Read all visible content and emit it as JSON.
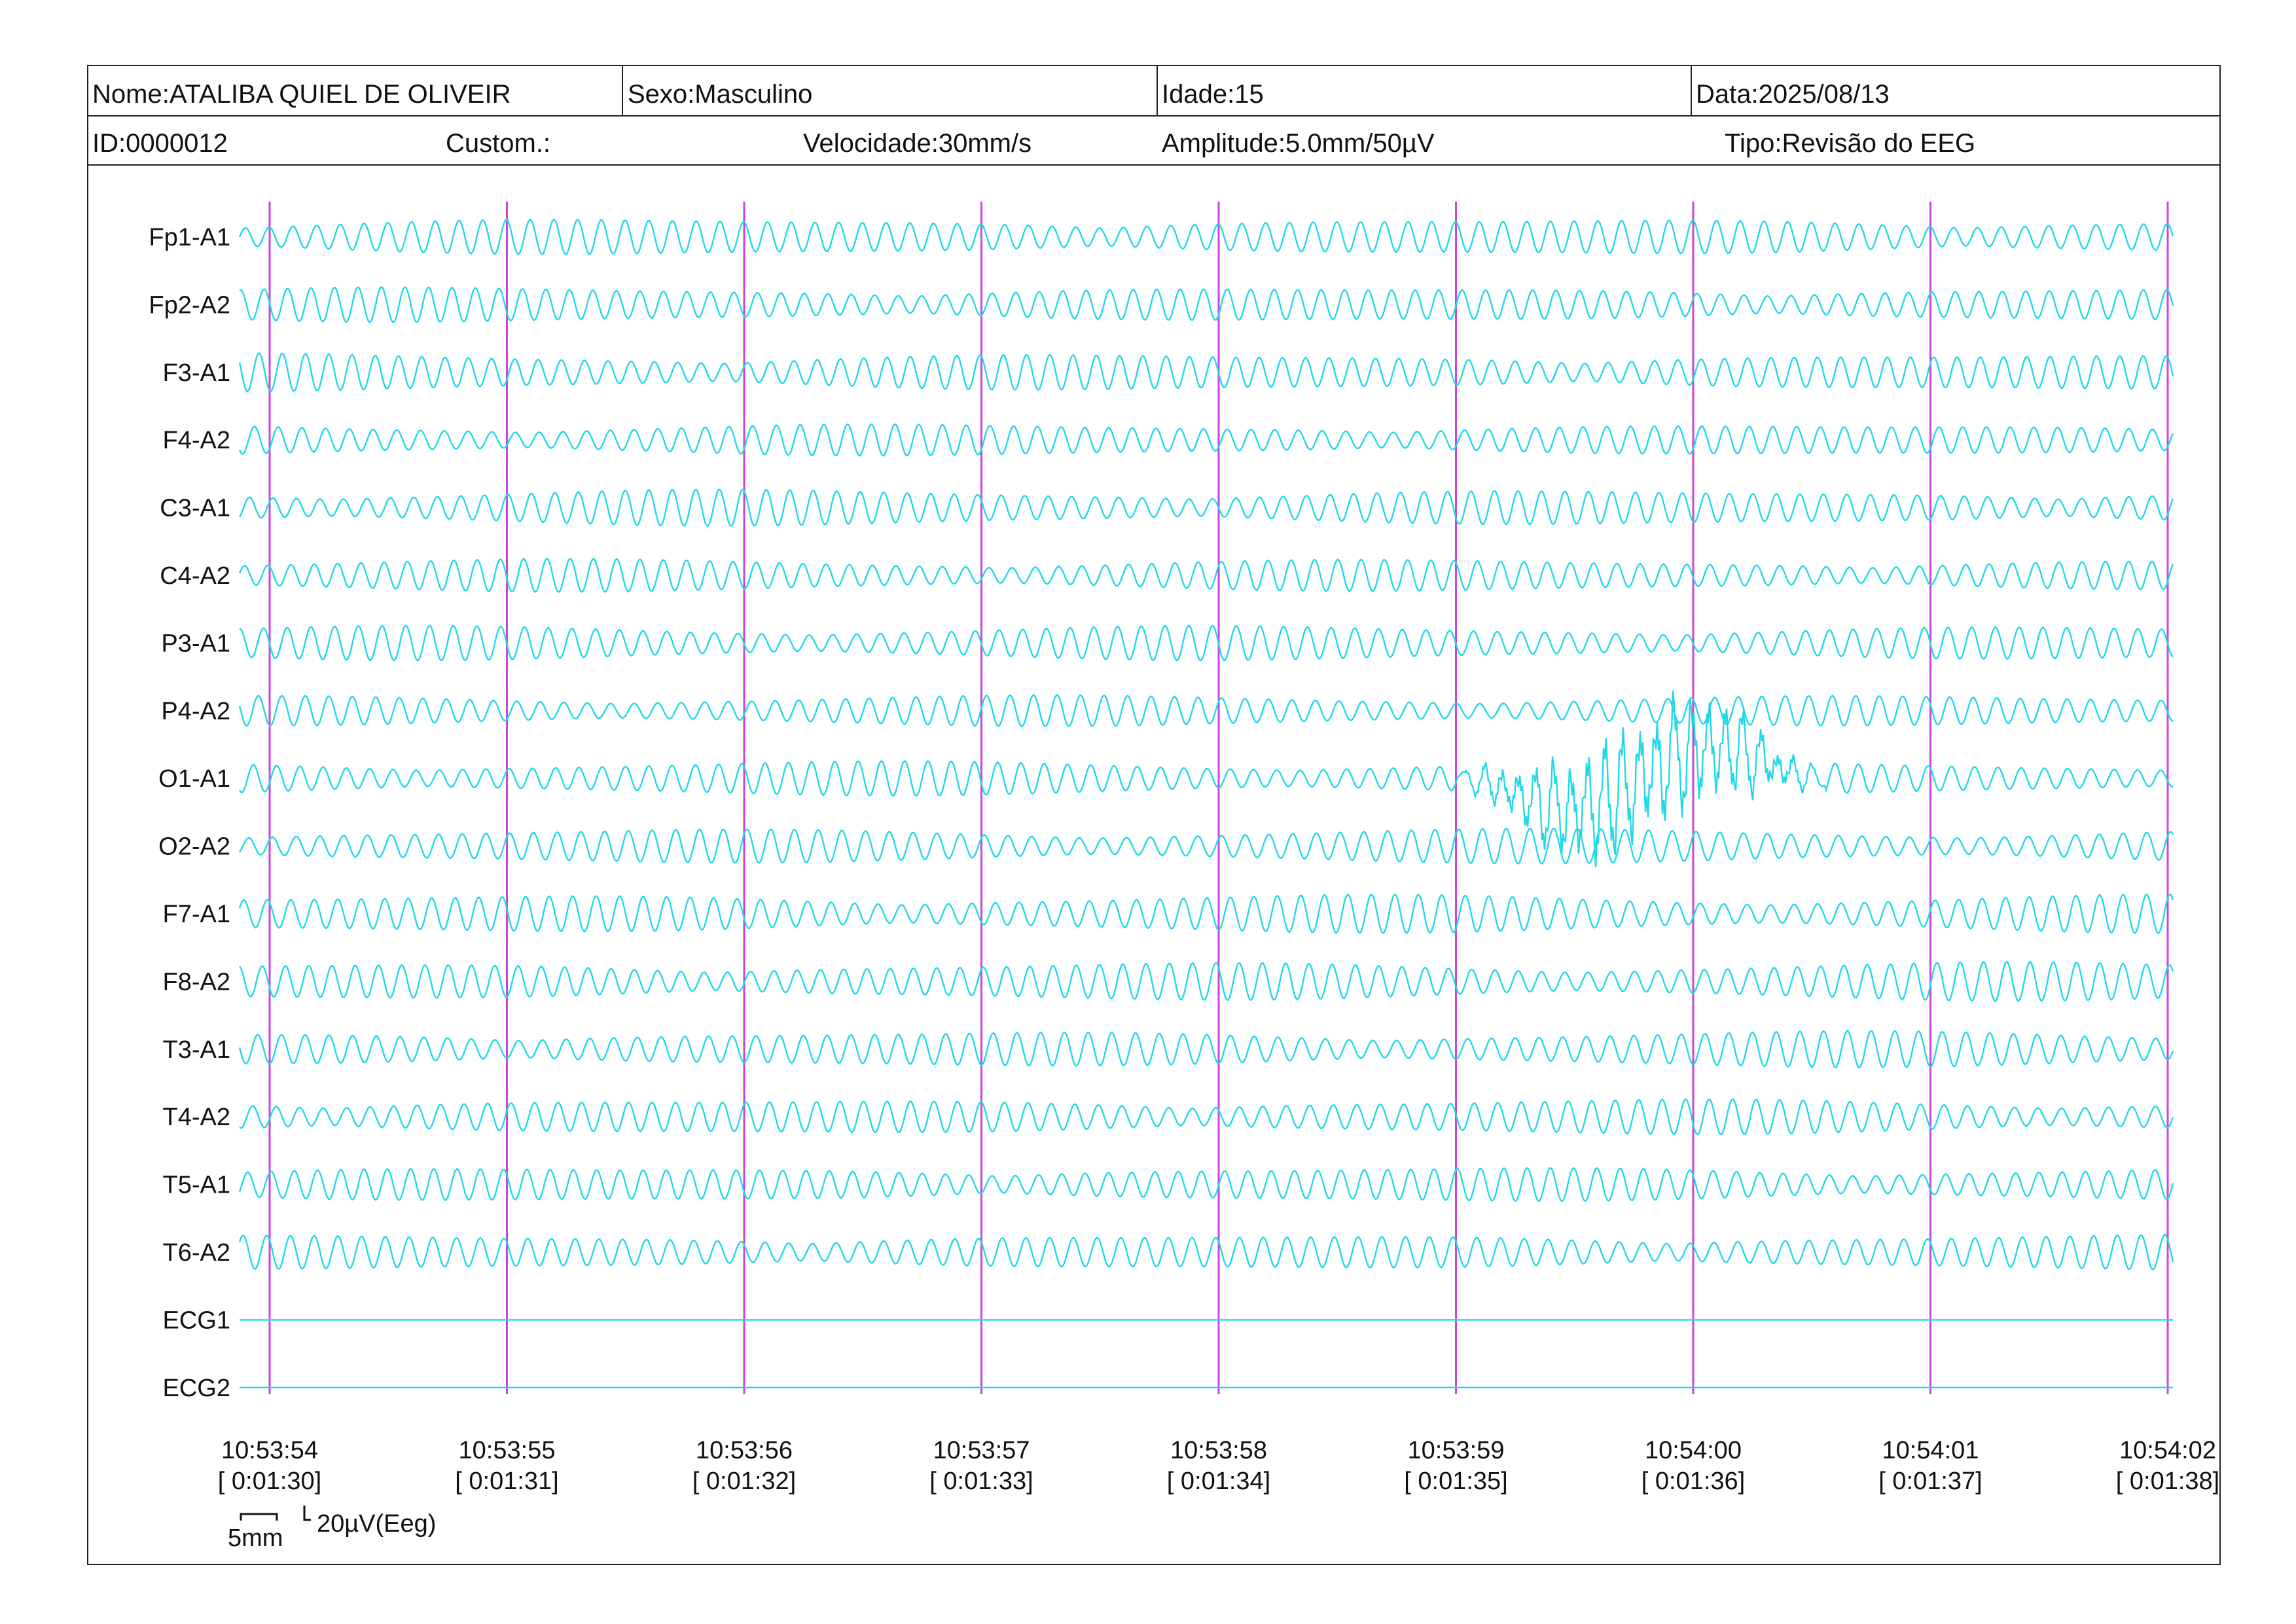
{
  "header": {
    "name": "Nome:ATALIBA QUIEL DE OLIVEIR",
    "sex": "Sexo:Masculino",
    "age": "Idade:15",
    "date": "Data:2025/08/13",
    "id": "ID:0000012",
    "custom": "Custom.:",
    "speed": "Velocidade:30mm/s",
    "amplitude": "Amplitude:5.0mm/50µV",
    "type": "Tipo:Revisão do EEG"
  },
  "calibration": {
    "time_label": "5mm",
    "amp_label": "20µV(Eeg)"
  },
  "colors": {
    "trace": "#22d8e8",
    "time_marker": "#cc44dd",
    "border": "#222222"
  },
  "chart_data": {
    "type": "line",
    "title": "",
    "channels": [
      {
        "name": "Fp1-A1",
        "kind": "eeg",
        "amplitude": 1.0
      },
      {
        "name": "Fp2-A2",
        "kind": "eeg",
        "amplitude": 0.95
      },
      {
        "name": "F3-A1",
        "kind": "eeg",
        "amplitude": 1.0
      },
      {
        "name": "F4-A2",
        "kind": "eeg",
        "amplitude": 0.85
      },
      {
        "name": "C3-A1",
        "kind": "eeg",
        "amplitude": 0.95
      },
      {
        "name": "C4-A2",
        "kind": "eeg",
        "amplitude": 0.85
      },
      {
        "name": "P3-A1",
        "kind": "eeg",
        "amplitude": 0.9
      },
      {
        "name": "P4-A2",
        "kind": "eeg",
        "amplitude": 0.8
      },
      {
        "name": "O1-A1",
        "kind": "eeg",
        "amplitude": 0.9,
        "artifact": [
          0.63,
          0.82
        ]
      },
      {
        "name": "O2-A2",
        "kind": "eeg",
        "amplitude": 0.9
      },
      {
        "name": "F7-A1",
        "kind": "eeg",
        "amplitude": 1.0
      },
      {
        "name": "F8-A2",
        "kind": "eeg",
        "amplitude": 1.0
      },
      {
        "name": "T3-A1",
        "kind": "eeg",
        "amplitude": 0.95
      },
      {
        "name": "T4-A2",
        "kind": "eeg",
        "amplitude": 0.95
      },
      {
        "name": "T5-A1",
        "kind": "eeg",
        "amplitude": 0.95
      },
      {
        "name": "T6-A2",
        "kind": "eeg",
        "amplitude": 0.95
      },
      {
        "name": "ECG1",
        "kind": "ecg",
        "amplitude": 0
      },
      {
        "name": "ECG2",
        "kind": "ecg",
        "amplitude": 0
      }
    ],
    "time_ticks": [
      {
        "clock": "10:53:54",
        "elapsed": "[ 0:01:30]"
      },
      {
        "clock": "10:53:55",
        "elapsed": "[ 0:01:31]"
      },
      {
        "clock": "10:53:56",
        "elapsed": "[ 0:01:32]"
      },
      {
        "clock": "10:53:57",
        "elapsed": "[ 0:01:33]"
      },
      {
        "clock": "10:53:58",
        "elapsed": "[ 0:01:34]"
      },
      {
        "clock": "10:53:59",
        "elapsed": "[ 0:01:35]"
      },
      {
        "clock": "10:54:00",
        "elapsed": "[ 0:01:36]"
      },
      {
        "clock": "10:54:01",
        "elapsed": "[ 0:01:37]"
      },
      {
        "clock": "10:54:02",
        "elapsed": "[ 0:01:38]"
      }
    ],
    "dominant_frequency_hz": 10,
    "grid": false
  }
}
